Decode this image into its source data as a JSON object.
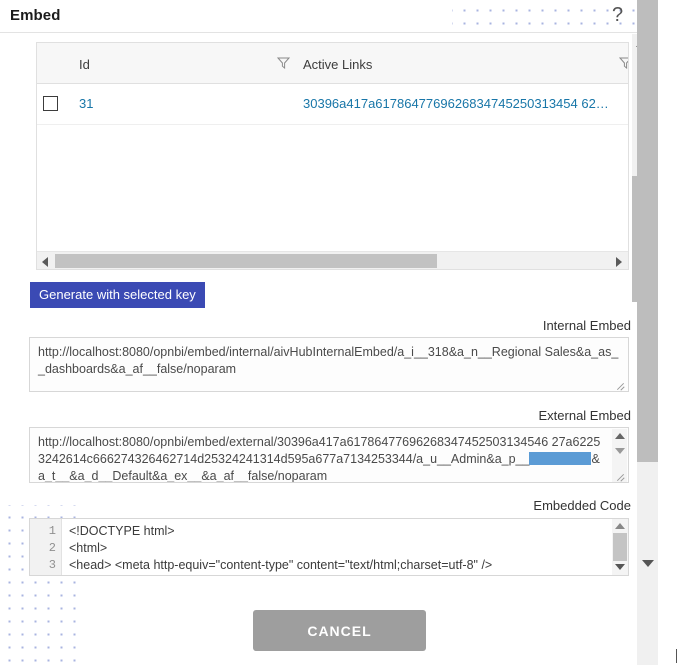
{
  "dialog": {
    "title": "Embed",
    "help_icon": "question-mark-icon",
    "close_icon": "close-icon"
  },
  "table": {
    "columns": [
      {
        "label": "Id",
        "filter_icon": "filter-icon"
      },
      {
        "label": "Active Links",
        "filter_icon": "filter-icon"
      }
    ],
    "rows": [
      {
        "checked": false,
        "id": "31",
        "active_link": "30396a417a6178647769626834745250313454 62…"
      }
    ]
  },
  "actions": {
    "generate_label": "Generate with selected key",
    "cancel_label": "CANCEL"
  },
  "internal_embed": {
    "label": "Internal Embed",
    "copy_icon": "copy-icon",
    "value": "http://localhost:8080/opnbi/embed/internal/aivHubInternalEmbed/a_i__318&a_n__Regional Sales&a_as__dashboards&a_af__false/noparam"
  },
  "external_embed": {
    "label": "External Embed",
    "copy_icon": "copy-icon",
    "value_before_redaction": "http://localhost:8080/opnbi/embed/external/30396a417a61786477696268347452503134546 27a62253242614c666274326462714d25324241314d595a677a7134253344/a_u__Admin&a_p__",
    "redacted": true,
    "value_after_redaction": "&a_t__&a_d__Default&a_ex__&a_af__false/noparam"
  },
  "embedded_code": {
    "label": "Embedded Code",
    "copy_icon": "copy-icon",
    "lines": [
      {
        "number": "1",
        "text": "<!DOCTYPE html>"
      },
      {
        "number": "2",
        "text": "<html>"
      },
      {
        "number": "3",
        "text": "<head> <meta http-equiv=\"content-type\" content=\"text/html;charset=utf-8\" />"
      }
    ]
  },
  "colors": {
    "primary_button": "#3b4ab4",
    "cancel_button": "#9e9e9e",
    "link_text": "#1876a8",
    "redaction": "#5b9bd5",
    "dot_pattern": "#a9b4e0"
  }
}
